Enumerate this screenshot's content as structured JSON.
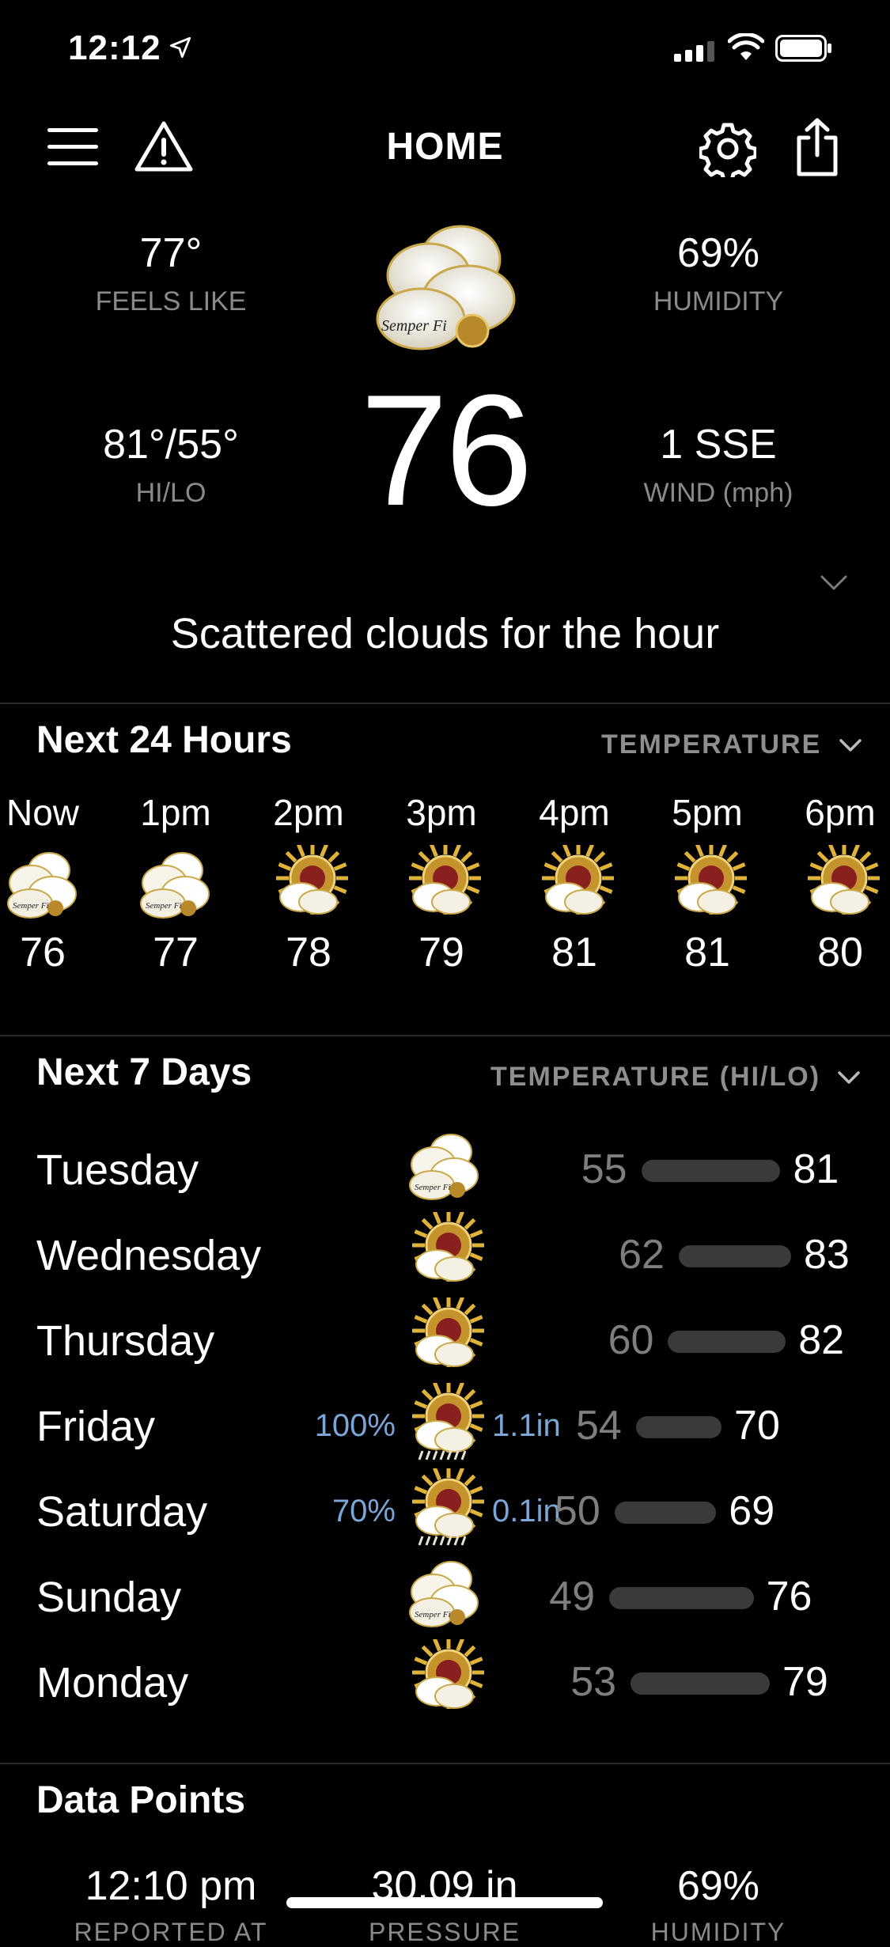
{
  "status": {
    "time": "12:12"
  },
  "nav": {
    "title": "HOME"
  },
  "current": {
    "feels_like": {
      "value": "77°",
      "label": "FEELS LIKE"
    },
    "humidity": {
      "value": "69%",
      "label": "HUMIDITY"
    },
    "hilo": {
      "value": "81°/55°",
      "label": "HI/LO"
    },
    "wind": {
      "value": "1 SSE",
      "label": "WIND (mph)"
    },
    "temperature": "76",
    "summary": "Scattered clouds for the hour",
    "icon": "semper-fi-cloudy-icon"
  },
  "hourly": {
    "title": "Next 24 Hours",
    "selector": "TEMPERATURE",
    "items": [
      {
        "time": "Now",
        "temp": "76",
        "icon": "cloudy"
      },
      {
        "time": "1pm",
        "temp": "77",
        "icon": "cloudy"
      },
      {
        "time": "2pm",
        "temp": "78",
        "icon": "partly-sunny"
      },
      {
        "time": "3pm",
        "temp": "79",
        "icon": "partly-sunny"
      },
      {
        "time": "4pm",
        "temp": "81",
        "icon": "partly-sunny"
      },
      {
        "time": "5pm",
        "temp": "81",
        "icon": "partly-sunny"
      },
      {
        "time": "6pm",
        "temp": "80",
        "icon": "partly-sunny"
      }
    ]
  },
  "daily": {
    "title": "Next 7 Days",
    "selector": "TEMPERATURE (HI/LO)",
    "days": [
      {
        "name": "Tuesday",
        "precip_chance": "",
        "precip_amount": "",
        "lo": "55",
        "hi": "81",
        "icon": "cloudy"
      },
      {
        "name": "Wednesday",
        "precip_chance": "",
        "precip_amount": "",
        "lo": "62",
        "hi": "83",
        "icon": "partly-sunny"
      },
      {
        "name": "Thursday",
        "precip_chance": "",
        "precip_amount": "",
        "lo": "60",
        "hi": "82",
        "icon": "partly-sunny"
      },
      {
        "name": "Friday",
        "precip_chance": "100%",
        "precip_amount": "1.1in",
        "lo": "54",
        "hi": "70",
        "icon": "rain"
      },
      {
        "name": "Saturday",
        "precip_chance": "70%",
        "precip_amount": "0.1in",
        "lo": "50",
        "hi": "69",
        "icon": "rain"
      },
      {
        "name": "Sunday",
        "precip_chance": "",
        "precip_amount": "",
        "lo": "49",
        "hi": "76",
        "icon": "cloudy"
      },
      {
        "name": "Monday",
        "precip_chance": "",
        "precip_amount": "",
        "lo": "53",
        "hi": "79",
        "icon": "partly-sunny"
      }
    ]
  },
  "data_points": {
    "title": "Data Points",
    "items": [
      {
        "value": "12:10 pm",
        "label": "REPORTED AT"
      },
      {
        "value": "30.09 in",
        "label": "PRESSURE"
      },
      {
        "value": "69%",
        "label": "HUMIDITY"
      }
    ]
  },
  "colors": {
    "background": "#000000",
    "precip": "#7aa6d8",
    "muted": "#8a8a8a",
    "bar": "#3a3a3a"
  }
}
